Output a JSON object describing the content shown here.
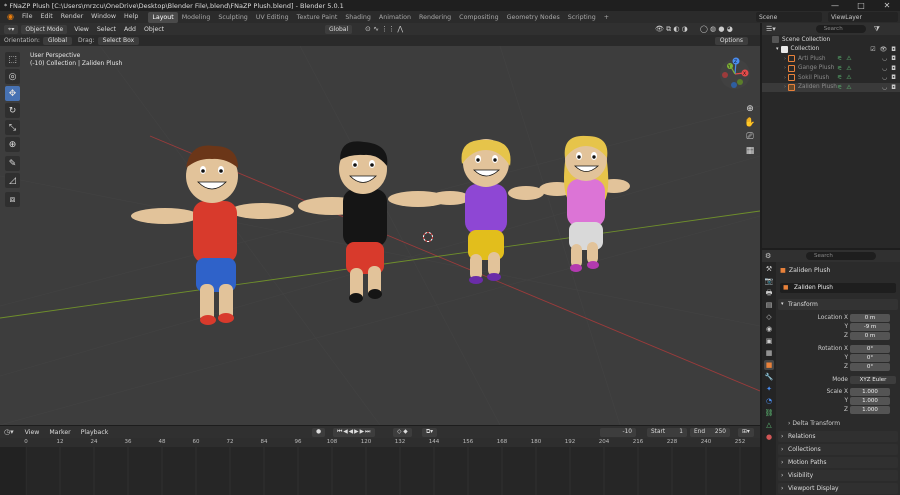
{
  "titlebar": {
    "title": "* FNaZP Plush [C:\\Users\\mrzcu\\OneDrive\\Desktop\\Blender File\\.blend\\FNaZP Plush.blend] - Blender 5.0.1",
    "minimize": "—",
    "maximize": "□",
    "close": "✕"
  },
  "menubar": {
    "menus": [
      "File",
      "Edit",
      "Render",
      "Window",
      "Help"
    ],
    "workspaces": [
      "Layout",
      "Modeling",
      "Sculpting",
      "UV Editing",
      "Texture Paint",
      "Shading",
      "Animation",
      "Rendering",
      "Compositing",
      "Geometry Nodes",
      "Scripting"
    ],
    "active_workspace": "Layout",
    "add_workspace": "+",
    "scene_label": "Scene",
    "view_layer_label": "ViewLayer"
  },
  "viewport_header": {
    "mode": "Object Mode",
    "menus": [
      "View",
      "Select",
      "Add",
      "Object"
    ],
    "transform_orientation": "Global",
    "options": "Options"
  },
  "tool_settings": {
    "orientation_label": "Orientation:",
    "orientation_value": "Global",
    "drag_label": "Drag:",
    "drag_value": "Select Box"
  },
  "viewport_info": {
    "perspective": "User Perspective",
    "collection_line": "(-10) Collection | Zaliden Plush"
  },
  "toolbar": {
    "tools": [
      "select-box-icon",
      "cursor-icon",
      "move-icon",
      "rotate-icon",
      "scale-icon",
      "transform-icon",
      "annotate-icon",
      "measure-icon",
      "add-cube-icon"
    ],
    "active_tool": "move-icon"
  },
  "gizmo": {
    "x": "X",
    "y": "Y",
    "z": "Z"
  },
  "outliner": {
    "search_placeholder": "Search",
    "scene_collection": "Scene Collection",
    "collection": "Collection",
    "items": [
      {
        "name": "Arti Plush",
        "color": "#e8813a"
      },
      {
        "name": "Gange Plush",
        "color": "#e8813a"
      },
      {
        "name": "Sokil Plush",
        "color": "#e8813a"
      },
      {
        "name": "Zaliden Plush",
        "color": "#e8813a"
      }
    ]
  },
  "properties": {
    "search_placeholder": "Search",
    "object_name": "Zaliden Plush",
    "object_field": "Zaliden Plush",
    "transform_title": "Transform",
    "location_label": "Location X",
    "location": {
      "x": "0 m",
      "y": "-9 m",
      "z": "0 m"
    },
    "rotation_label": "Rotation X",
    "rotation": {
      "x": "0°",
      "y": "0°",
      "z": "0°"
    },
    "mode_label": "Mode",
    "mode_value": "XYZ Euler",
    "scale_label": "Scale X",
    "scale": {
      "x": "1.000",
      "y": "1.000",
      "z": "1.000"
    },
    "axis_y": "Y",
    "axis_z": "Z",
    "sections": [
      "Delta Transform",
      "Relations",
      "Collections",
      "Motion Paths",
      "Visibility",
      "Viewport Display"
    ]
  },
  "timeline": {
    "menus": [
      "View",
      "Marker",
      "Playback"
    ],
    "current_frame": "-10",
    "start_label": "Start",
    "start_value": "1",
    "end_label": "End",
    "end_value": "250",
    "ruler": [
      "0",
      "12",
      "24",
      "36",
      "48",
      "60",
      "72",
      "84",
      "96",
      "108",
      "120",
      "132",
      "144",
      "156",
      "168",
      "180",
      "192",
      "204",
      "216",
      "228",
      "240",
      "252"
    ]
  },
  "colors": {
    "accent": "#4772b3",
    "viewport_bg": "#3d3d3d",
    "grid_x": "#9b3b3b",
    "grid_y": "#6f8f2b"
  }
}
